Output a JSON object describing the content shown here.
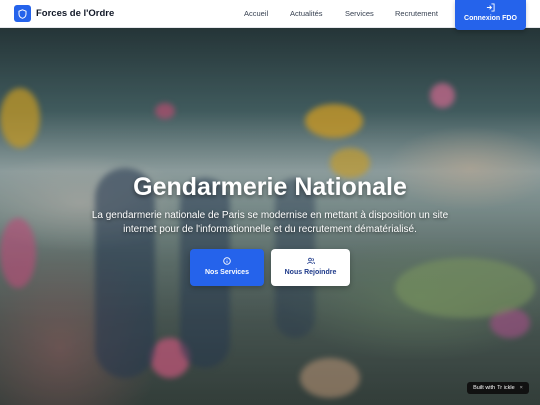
{
  "navbar": {
    "brand": "Forces de l'Ordre",
    "links": [
      "Accueil",
      "Actualités",
      "Services",
      "Recrutement"
    ],
    "cta_label": "Connexion FDO"
  },
  "hero": {
    "title": "Gendarmerie Nationale",
    "subtitle": "La gendarmerie nationale de Paris se modernise en mettant à disposition un site internet pour de l'informationnelle et du recrutement dématérialisé.",
    "primary_button": "Nos Services",
    "secondary_button": "Nous Rejoindre"
  },
  "badge": {
    "text": "Built with",
    "brand": "Tr ickle",
    "close": "×"
  },
  "colors": {
    "accent": "#2563eb",
    "navbar_bg": "#ffffff",
    "text_dark": "#111827"
  },
  "icons": {
    "logo": "shield-icon",
    "cta": "login-icon",
    "primary": "info-icon",
    "secondary": "users-icon"
  }
}
